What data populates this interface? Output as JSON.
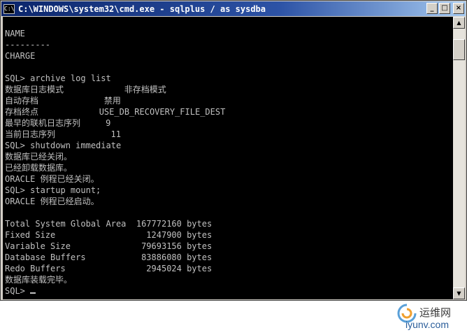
{
  "window": {
    "icon_label": "C:\\",
    "title": "C:\\WINDOWS\\system32\\cmd.exe - sqlplus / as sysdba",
    "buttons": {
      "minimize": "_",
      "maximize": "□",
      "close": "×"
    }
  },
  "console": {
    "lines": [
      "",
      "NAME",
      "---------",
      "CHARGE",
      "",
      "SQL> archive log list",
      "数据库日志模式            非存档模式",
      "自动存档             禁用",
      "存档终点            USE_DB_RECOVERY_FILE_DEST",
      "最早的联机日志序列     9",
      "当前日志序列           11",
      "SQL> shutdown immediate",
      "数据库已经关闭。",
      "已经卸载数据库。",
      "ORACLE 例程已经关闭。",
      "SQL> startup mount;",
      "ORACLE 例程已经启动。",
      "",
      "Total System Global Area  167772160 bytes",
      "Fixed Size                  1247900 bytes",
      "Variable Size              79693156 bytes",
      "Database Buffers           83886080 bytes",
      "Redo Buffers                2945024 bytes",
      "数据库装载完毕。",
      "SQL> "
    ]
  },
  "scrollbar": {
    "up_arrow": "▲",
    "down_arrow": "▼"
  },
  "watermark": {
    "cn": "运维网",
    "url": "iyunv.com"
  }
}
